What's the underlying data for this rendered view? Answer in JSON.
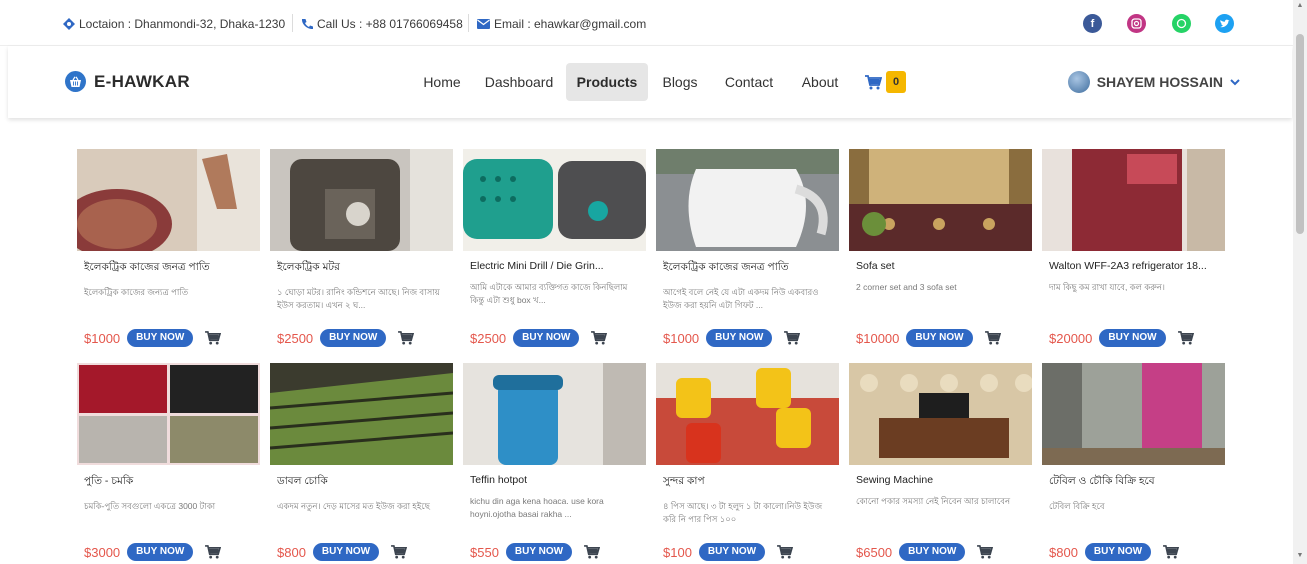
{
  "topbar": {
    "location": "Loctaion : Dhanmondi-32, Dhaka-1230",
    "phone": "Call Us : +88 01766069458",
    "email": "Email : ehawkar@gmail.com",
    "socials": [
      {
        "icon": "facebook-icon",
        "color": "#3b5998"
      },
      {
        "icon": "instagram-icon",
        "color": "#c13584"
      },
      {
        "icon": "whatsapp-icon",
        "color": "#25d366"
      },
      {
        "icon": "twitter-icon",
        "color": "#1da1f2"
      }
    ]
  },
  "brand": {
    "name": "E-HAWKAR",
    "logo_icon": "basket-icon"
  },
  "nav": {
    "items": [
      "Home",
      "Dashboard",
      "Products",
      "Blogs",
      "Contact",
      "About"
    ],
    "active": "Products",
    "cart_count": "0"
  },
  "user": {
    "name": "SHAYEM HOSSAIN"
  },
  "colors": {
    "accent": "#2f68c4",
    "price": "#e4574c",
    "badge": "#f5b700"
  },
  "buy_label": "BUY NOW",
  "products": [
    {
      "name": "ইলেকট্রিক কাজের জনত্র পাতি",
      "desc": "ইলেকট্রিক কাজের জন্যত্র পাতি",
      "price": "$1000"
    },
    {
      "name": "ইলেকট্রিক মটর",
      "desc": "১ ঘোড়া মটর। রানিং কন্ডিশনে আছে। নিজ বাসায় ইউস করতাম। এখন ২ ঘ...",
      "price": "$2500"
    },
    {
      "name": "Electric Mini Drill / Die Grin...",
      "desc": "আমি এটাকে আমার ব্যক্তিগত কাজে কিনছিলাম কিন্তু এটা শুধু box খ...",
      "price": "$2500"
    },
    {
      "name": "ইলেকট্রিক কাজের জনত্র পাতি",
      "desc": "আগেই বলে নেই যে এটা একদম নিউ একবারও ইউজ করা হয়নি এটা গিফট ...",
      "price": "$1000"
    },
    {
      "name": "Sofa set",
      "desc": "2 corner set and 3 sofa set",
      "price": "$10000"
    },
    {
      "name": "Walton WFF-2A3 refrigerator 18...",
      "desc": "দাম কিছু কম রাখা যাবে, কল করুন।",
      "price": "$20000"
    },
    {
      "name": "পুতি - চমকি",
      "desc": "চমকি-পুতি সবগুলো একত্রে 3000 টাকা",
      "price": "$3000"
    },
    {
      "name": "ডাবল চোকি",
      "desc": "একদম নতুন। দেড় মাসের মত ইউজ করা হইছে",
      "price": "$800"
    },
    {
      "name": "Teffin hotpot",
      "desc": "kichu din aga kena hoaca. use kora hoyni.ojotha basai rakha ...",
      "price": "$550"
    },
    {
      "name": "সুন্দর কাপ",
      "desc": "৪ পিস আছে। ৩ টা হলুদ ১ টা কালো।নিউ ইউজ করি নি পার পিস ১০০",
      "price": "$100"
    },
    {
      "name": "Sewing Machine",
      "desc": "কোনো পকার সমস্যা নেই নিবেন আর চালাবেন",
      "price": "$6500"
    },
    {
      "name": "টেবিল ও চৌকি বিক্রি হবে",
      "desc": "টেবিল বিক্রি হবে",
      "price": "$800"
    }
  ]
}
